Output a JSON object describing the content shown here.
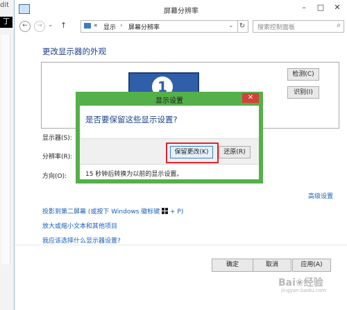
{
  "background": {
    "left_text": "dit",
    "left_badge": "丁"
  },
  "window": {
    "title": "屏幕分辨率",
    "minimize": "–",
    "maximize": "□",
    "close": "✕"
  },
  "nav": {
    "back": "←",
    "forward": "→",
    "history": "⌄",
    "up": "↑",
    "breadcrumb_sep1": "«",
    "crumb1": "显示",
    "crumb_arrow": "›",
    "crumb2": "屏幕分辨率",
    "dropdown": "⌄",
    "refresh": "↻",
    "search_placeholder": "搜索控制面板",
    "search_icon": "⌕"
  },
  "content": {
    "heading": "更改显示器的外观",
    "monitor_number": "1",
    "detect_label": "检测(C)",
    "identify_label": "识别(I)",
    "display_label": "显示器(S):",
    "resolution_label": "分辨率(R):",
    "orientation_label": "方向(O):",
    "advanced_link": "高级设置",
    "link_project": "投影到第二屏幕 (或按下 Windows 徽标键 ",
    "link_project_suffix": " + P)",
    "link_text_size": "放大或缩小文本和其他项目",
    "link_help": "我应该选择什么显示器设置?"
  },
  "dialog": {
    "title": "显示设置",
    "close": "✕",
    "question": "是否要保留这些显示设置?",
    "keep_label": "保留更改(K)",
    "revert_label": "还原(R)",
    "countdown_note": "15 秒钟后转换为以前的显示设置。"
  },
  "footer": {
    "ok_label": "确定",
    "cancel_label": "取消",
    "apply_label": "应用(A)"
  },
  "watermark": {
    "main": "Bai❀经验",
    "sub": "jingyan.baidu.com"
  },
  "colors": {
    "dialog_border": "#54b04a",
    "highlight": "#e3232c",
    "heading": "#1e3f8a",
    "link": "#1a5fb4"
  }
}
